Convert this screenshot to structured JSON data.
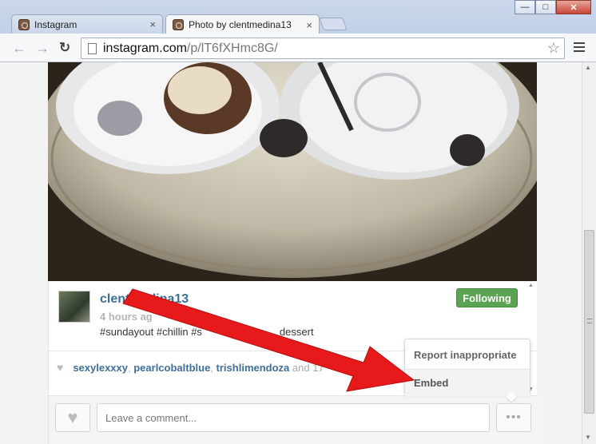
{
  "browser": {
    "tabs": [
      {
        "title": "Instagram",
        "active": false
      },
      {
        "title": "Photo by clentmedina13",
        "active": true
      }
    ],
    "url_host": "instagram.com",
    "url_path": "/p/lT6fXHmc8G/"
  },
  "post": {
    "username": "clentmedina13",
    "time_ago": "4 hours ag",
    "caption": "#sundayout #chillin #s",
    "caption_tail": "dessert",
    "follow_label": "Following",
    "likers": [
      "sexylexxxy",
      "pearlcobaltblue",
      "trishlimendoza"
    ],
    "likes_suffix": "and 17"
  },
  "comment": {
    "placeholder": "Leave a comment..."
  },
  "menu": {
    "report_label": "Report inappropriate",
    "embed_label": "Embed"
  },
  "colors": {
    "follow_green": "#5aa352",
    "username_blue": "#3f6f99",
    "arrow_red": "#e8191a"
  }
}
